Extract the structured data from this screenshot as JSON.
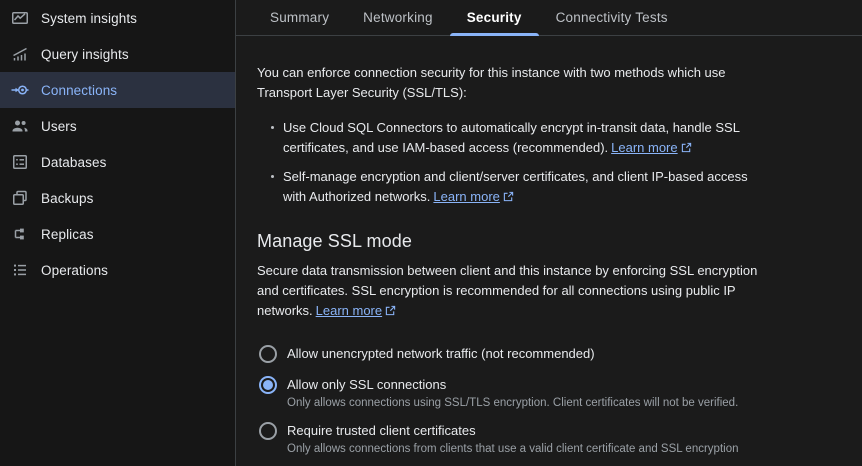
{
  "colors": {
    "accent": "#8ab4f8",
    "sidebar_bg": "#161616",
    "main_bg": "#1b1b1b",
    "selected_item_bg": "#2b3140",
    "text_primary": "#e8eaed",
    "text_secondary": "#9aa0a6",
    "divider": "#3c4043"
  },
  "sidebar": {
    "items": [
      {
        "label": "System insights",
        "icon": "system-insights-icon",
        "selected": false
      },
      {
        "label": "Query insights",
        "icon": "query-insights-icon",
        "selected": false
      },
      {
        "label": "Connections",
        "icon": "connections-icon",
        "selected": true
      },
      {
        "label": "Users",
        "icon": "users-icon",
        "selected": false
      },
      {
        "label": "Databases",
        "icon": "databases-icon",
        "selected": false
      },
      {
        "label": "Backups",
        "icon": "backups-icon",
        "selected": false
      },
      {
        "label": "Replicas",
        "icon": "replicas-icon",
        "selected": false
      },
      {
        "label": "Operations",
        "icon": "operations-icon",
        "selected": false
      }
    ]
  },
  "tabs": {
    "items": [
      {
        "label": "Summary",
        "active": false
      },
      {
        "label": "Networking",
        "active": false
      },
      {
        "label": "Security",
        "active": true
      },
      {
        "label": "Connectivity Tests",
        "active": false
      }
    ]
  },
  "security_tab": {
    "intro": "You can enforce connection security for this instance with two methods which use Transport Layer Security (SSL/TLS):",
    "methods": [
      {
        "text": "Use Cloud SQL Connectors to automatically encrypt in-transit data, handle SSL certificates, and use IAM-based access (recommended).",
        "link_label": "Learn more"
      },
      {
        "text": "Self-manage encryption and client/server certificates, and client IP-based access with Authorized networks.",
        "link_label": "Learn more"
      }
    ],
    "ssl": {
      "heading": "Manage SSL mode",
      "description": "Secure data transmission between client and this instance by enforcing SSL encryption and certificates. SSL encryption is recommended for all connections using public IP networks.",
      "link_label": "Learn more",
      "options": [
        {
          "label": "Allow unencrypted network traffic (not recommended)",
          "description": "",
          "selected": false
        },
        {
          "label": "Allow only SSL connections",
          "description": "Only allows connections using SSL/TLS encryption. Client certificates will not be verified.",
          "selected": true
        },
        {
          "label": "Require trusted client certificates",
          "description": "Only allows connections from clients that use a valid client certificate and SSL encryption",
          "selected": false
        }
      ]
    }
  }
}
